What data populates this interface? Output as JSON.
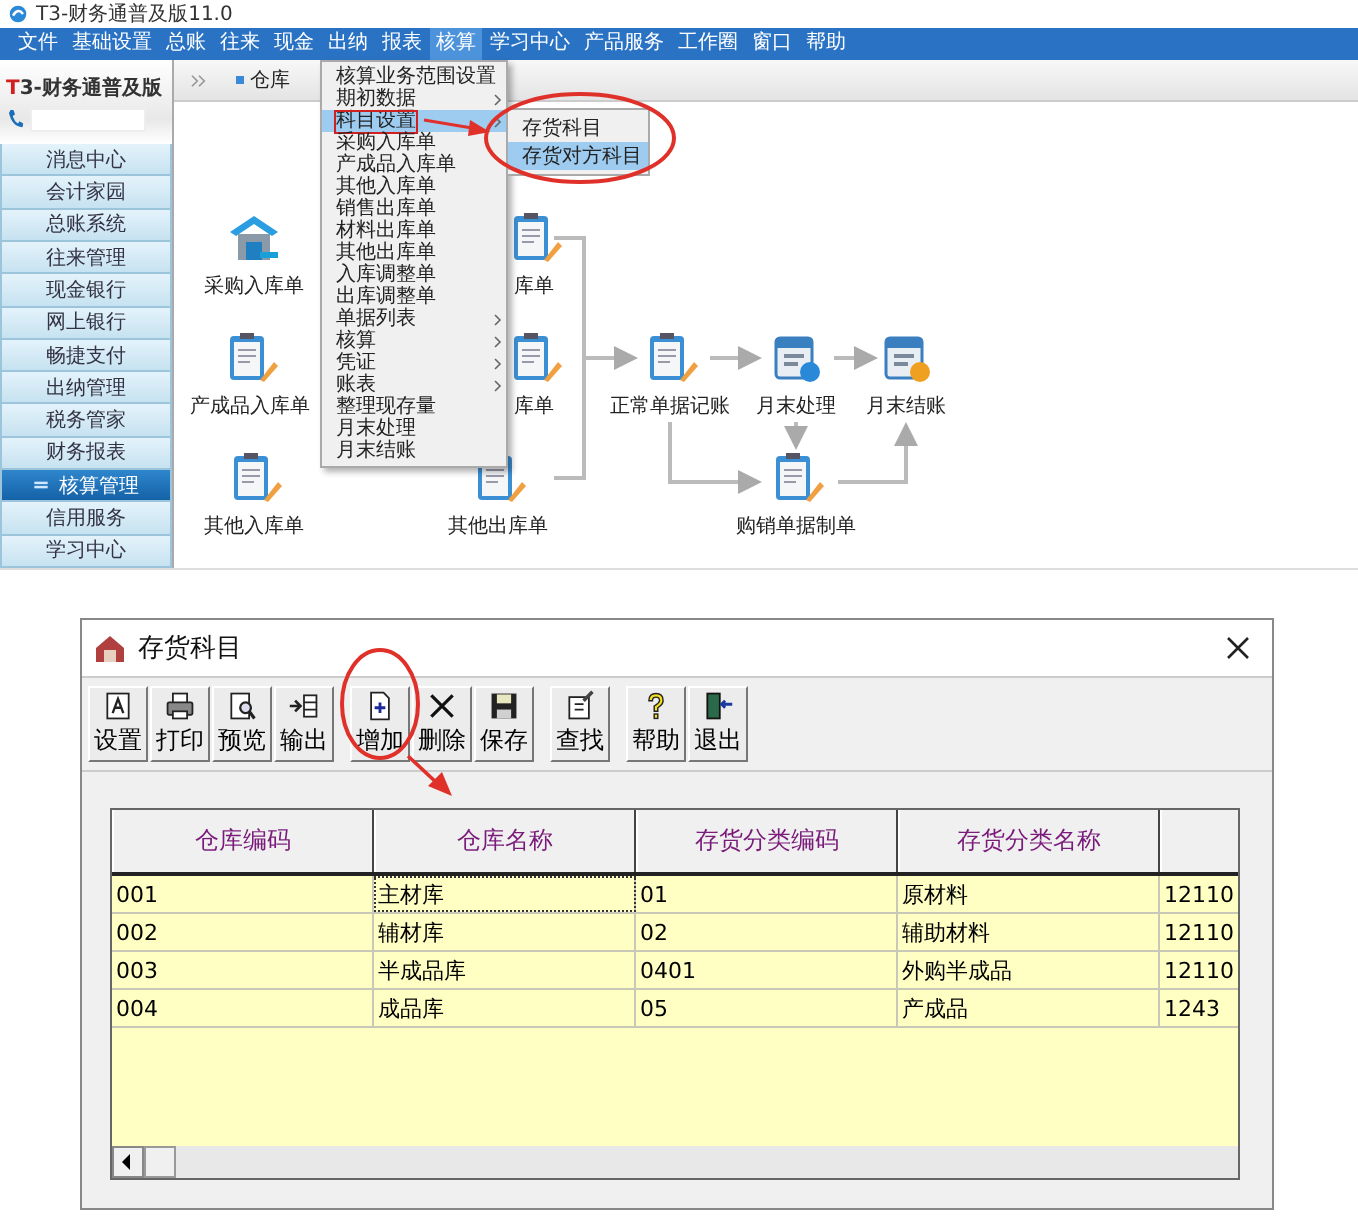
{
  "window": {
    "title": "T3-财务通普及版11.0"
  },
  "menu_bar": [
    {
      "label": "文件",
      "open": false
    },
    {
      "label": "基础设置",
      "open": false
    },
    {
      "label": "总账",
      "open": false
    },
    {
      "label": "往来",
      "open": false
    },
    {
      "label": "现金",
      "open": false
    },
    {
      "label": "出纳",
      "open": false
    },
    {
      "label": "报表",
      "open": false
    },
    {
      "label": "核算",
      "open": true
    },
    {
      "label": "学习中心",
      "open": false
    },
    {
      "label": "产品服务",
      "open": false
    },
    {
      "label": "工作圈",
      "open": false
    },
    {
      "label": "窗口",
      "open": false
    },
    {
      "label": "帮助",
      "open": false
    }
  ],
  "sidebar": {
    "logo_mark": "T",
    "logo_text": "3-财务通普及版",
    "items": [
      {
        "label": "消息中心",
        "selected": false
      },
      {
        "label": "会计家园",
        "selected": false
      },
      {
        "label": "总账系统",
        "selected": false
      },
      {
        "label": "往来管理",
        "selected": false
      },
      {
        "label": "现金银行",
        "selected": false
      },
      {
        "label": "网上银行",
        "selected": false
      },
      {
        "label": "畅捷支付",
        "selected": false
      },
      {
        "label": "出纳管理",
        "selected": false
      },
      {
        "label": "税务管家",
        "selected": false
      },
      {
        "label": "财务报表",
        "selected": false
      },
      {
        "label": "核算管理",
        "selected": true
      },
      {
        "label": "信用服务",
        "selected": false
      },
      {
        "label": "学习中心",
        "selected": false
      }
    ]
  },
  "tabs": [
    {
      "label": "仓库",
      "selected": true
    }
  ],
  "flow": {
    "nodes": [
      {
        "label": "采购入库单",
        "kind": "warehouse"
      },
      {
        "label": "产成品入库单",
        "kind": "clipboard"
      },
      {
        "label": "其他入库单",
        "kind": "clipboard"
      },
      {
        "label": "库单",
        "kind": "clipboard"
      },
      {
        "label": "库单",
        "kind": "clipboard"
      },
      {
        "label": "其他出库单",
        "kind": "clipboard"
      },
      {
        "label": "正常单据记账",
        "kind": "clipboard"
      },
      {
        "label": "月末处理",
        "kind": "calendar"
      },
      {
        "label": "月末结账",
        "kind": "calendar"
      },
      {
        "label": "购销单据制单",
        "kind": "clipboard"
      }
    ]
  },
  "dropdown": {
    "items": [
      {
        "label": "核算业务范围设置",
        "submenu": false,
        "selected": false
      },
      {
        "label": "期初数据",
        "submenu": true,
        "selected": false
      },
      {
        "label": "科目设置",
        "submenu": true,
        "selected": true
      },
      {
        "label": "采购入库单",
        "submenu": false,
        "selected": false
      },
      {
        "label": "产成品入库单",
        "submenu": false,
        "selected": false
      },
      {
        "label": "其他入库单",
        "submenu": false,
        "selected": false
      },
      {
        "label": "销售出库单",
        "submenu": false,
        "selected": false
      },
      {
        "label": "材料出库单",
        "submenu": false,
        "selected": false
      },
      {
        "label": "其他出库单",
        "submenu": false,
        "selected": false
      },
      {
        "label": "入库调整单",
        "submenu": false,
        "selected": false
      },
      {
        "label": "出库调整单",
        "submenu": false,
        "selected": false
      },
      {
        "label": "单据列表",
        "submenu": true,
        "selected": false
      },
      {
        "label": "核算",
        "submenu": true,
        "selected": false
      },
      {
        "label": "凭证",
        "submenu": true,
        "selected": false
      },
      {
        "label": "账表",
        "submenu": true,
        "selected": false
      },
      {
        "label": "整理现存量",
        "submenu": false,
        "selected": false
      },
      {
        "label": "月末处理",
        "submenu": false,
        "selected": false
      },
      {
        "label": "月末结账",
        "submenu": false,
        "selected": false
      }
    ]
  },
  "submenu": {
    "items": [
      {
        "label": "存货科目",
        "selected": false
      },
      {
        "label": "存货对方科目",
        "selected": true
      }
    ]
  },
  "dialog": {
    "title": "存货科目",
    "toolbar": [
      [
        {
          "label": "设置",
          "kind": "setup"
        },
        {
          "label": "打印",
          "kind": "print"
        },
        {
          "label": "预览",
          "kind": "preview"
        },
        {
          "label": "输出",
          "kind": "export"
        }
      ],
      [
        {
          "label": "增加",
          "kind": "add"
        },
        {
          "label": "删除",
          "kind": "delete"
        },
        {
          "label": "保存",
          "kind": "save"
        }
      ],
      [
        {
          "label": "查找",
          "kind": "find"
        }
      ],
      [
        {
          "label": "帮助",
          "kind": "help"
        },
        {
          "label": "退出",
          "kind": "exit"
        }
      ]
    ],
    "table": {
      "columns": [
        "仓库编码",
        "仓库名称",
        "存货分类编码",
        "存货分类名称"
      ],
      "rows": [
        {
          "cells": [
            {
              "text": "001",
              "focused": false
            },
            {
              "text": "主材库",
              "focused": true
            },
            {
              "text": "01",
              "focused": false
            },
            {
              "text": "原材料",
              "focused": false
            },
            {
              "text": "12110",
              "focused": false
            }
          ]
        },
        {
          "cells": [
            {
              "text": "002",
              "focused": false
            },
            {
              "text": "辅材库",
              "focused": false
            },
            {
              "text": "02",
              "focused": false
            },
            {
              "text": "辅助材料",
              "focused": false
            },
            {
              "text": "12110",
              "focused": false
            }
          ]
        },
        {
          "cells": [
            {
              "text": "003",
              "focused": false
            },
            {
              "text": "半成品库",
              "focused": false
            },
            {
              "text": "0401",
              "focused": false
            },
            {
              "text": "外购半成品",
              "focused": false
            },
            {
              "text": "12110",
              "focused": false
            }
          ]
        },
        {
          "cells": [
            {
              "text": "004",
              "focused": false
            },
            {
              "text": "成品库",
              "focused": false
            },
            {
              "text": "05",
              "focused": false
            },
            {
              "text": "产成品",
              "focused": false
            },
            {
              "text": "1243",
              "focused": false
            }
          ]
        }
      ]
    }
  }
}
